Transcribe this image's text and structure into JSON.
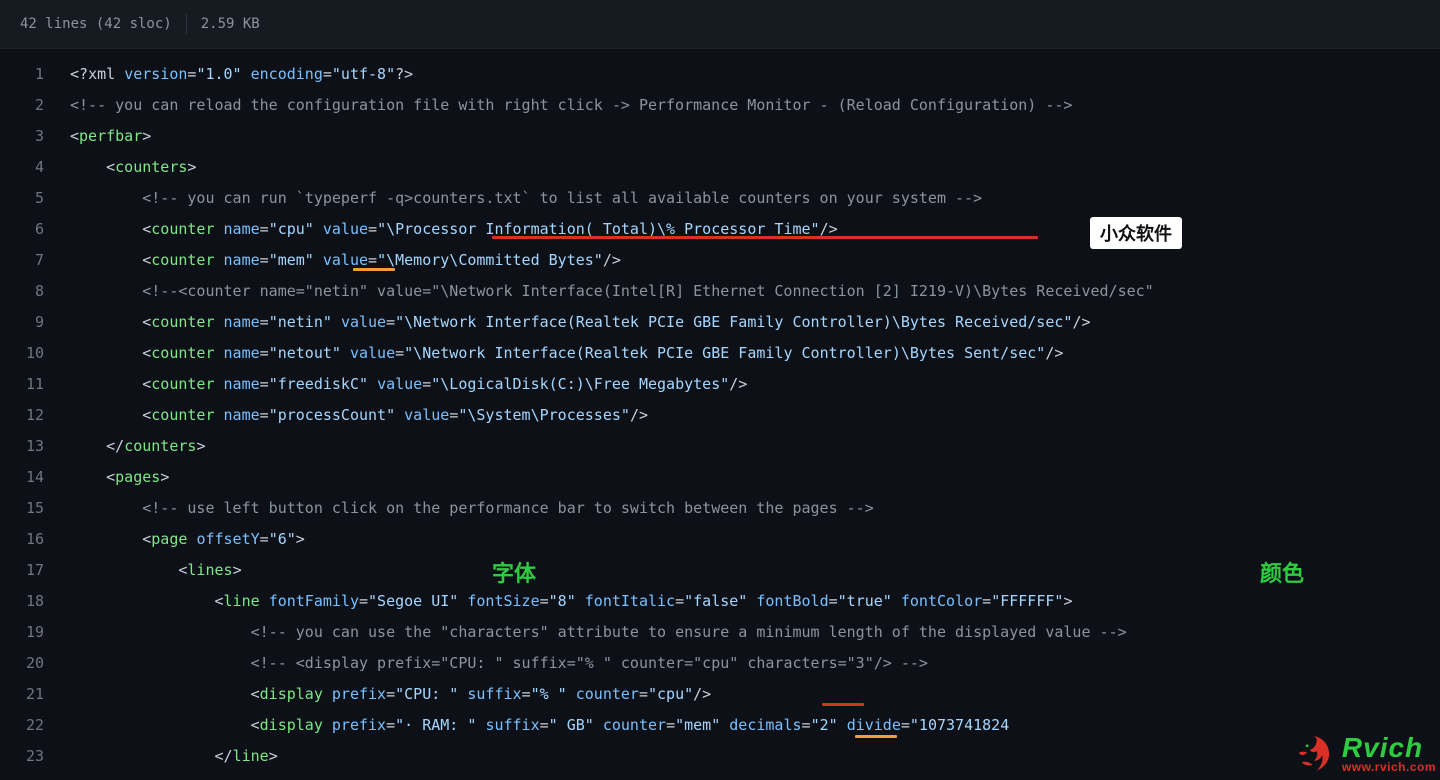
{
  "header": {
    "lines_label": "42 lines (42 sloc)",
    "size_label": "2.59 KB"
  },
  "annotations": {
    "badge_appinn": "小众软件",
    "label_font": "字体",
    "label_color": "颜色"
  },
  "watermark": {
    "brand": "Rvich",
    "url": "www.rvich.com"
  },
  "code_lines": [
    {
      "n": 1,
      "tokens": [
        {
          "t": "ang",
          "v": "<?"
        },
        {
          "t": "pi",
          "v": "xml "
        },
        {
          "t": "attr",
          "v": "version"
        },
        {
          "t": "ang",
          "v": "="
        },
        {
          "t": "str",
          "v": "\"1.0\""
        },
        {
          "t": "pi",
          "v": " "
        },
        {
          "t": "attr",
          "v": "encoding"
        },
        {
          "t": "ang",
          "v": "="
        },
        {
          "t": "str",
          "v": "\"utf-8\""
        },
        {
          "t": "ang",
          "v": "?>"
        }
      ]
    },
    {
      "n": 2,
      "tokens": [
        {
          "t": "cmt",
          "v": "<!-- you can reload the configuration file with right click -> Performance Monitor - (Reload Configuration) -->"
        }
      ]
    },
    {
      "n": 3,
      "tokens": [
        {
          "t": "ang",
          "v": "<"
        },
        {
          "t": "tag",
          "v": "perfbar"
        },
        {
          "t": "ang",
          "v": ">"
        }
      ]
    },
    {
      "n": 4,
      "indent": 1,
      "tokens": [
        {
          "t": "ang",
          "v": "<"
        },
        {
          "t": "tag",
          "v": "counters"
        },
        {
          "t": "ang",
          "v": ">"
        }
      ]
    },
    {
      "n": 5,
      "indent": 2,
      "tokens": [
        {
          "t": "cmt",
          "v": "<!-- you can run `typeperf -q>counters.txt` to list all available counters on your system -->"
        }
      ]
    },
    {
      "n": 6,
      "indent": 2,
      "tokens": [
        {
          "t": "ang",
          "v": "<"
        },
        {
          "t": "tag",
          "v": "counter "
        },
        {
          "t": "attr",
          "v": "name"
        },
        {
          "t": "ang",
          "v": "="
        },
        {
          "t": "str",
          "v": "\"cpu\""
        },
        {
          "t": "pi",
          "v": " "
        },
        {
          "t": "attr",
          "v": "value"
        },
        {
          "t": "ang",
          "v": "="
        },
        {
          "t": "str",
          "v": "\"\\Processor Information(_Total)\\% Processor Time\""
        },
        {
          "t": "ang",
          "v": "/>"
        }
      ]
    },
    {
      "n": 7,
      "indent": 2,
      "tokens": [
        {
          "t": "ang",
          "v": "<"
        },
        {
          "t": "tag",
          "v": "counter "
        },
        {
          "t": "attr",
          "v": "name"
        },
        {
          "t": "ang",
          "v": "="
        },
        {
          "t": "str",
          "v": "\"mem\""
        },
        {
          "t": "pi",
          "v": " "
        },
        {
          "t": "attr",
          "v": "value"
        },
        {
          "t": "ang",
          "v": "="
        },
        {
          "t": "str",
          "v": "\"\\Memory\\Committed Bytes\""
        },
        {
          "t": "ang",
          "v": "/>"
        }
      ]
    },
    {
      "n": 8,
      "indent": 2,
      "tokens": [
        {
          "t": "cmt",
          "v": "<!--<counter name=\"netin\" value=\"\\Network Interface(Intel[R] Ethernet Connection [2] I219-V)\\Bytes Received/sec\""
        }
      ]
    },
    {
      "n": 9,
      "indent": 2,
      "tokens": [
        {
          "t": "ang",
          "v": "<"
        },
        {
          "t": "tag",
          "v": "counter "
        },
        {
          "t": "attr",
          "v": "name"
        },
        {
          "t": "ang",
          "v": "="
        },
        {
          "t": "str",
          "v": "\"netin\""
        },
        {
          "t": "pi",
          "v": " "
        },
        {
          "t": "attr",
          "v": "value"
        },
        {
          "t": "ang",
          "v": "="
        },
        {
          "t": "str",
          "v": "\"\\Network Interface(Realtek PCIe GBE Family Controller)\\Bytes Received/sec\""
        },
        {
          "t": "ang",
          "v": "/>"
        }
      ]
    },
    {
      "n": 10,
      "indent": 2,
      "tokens": [
        {
          "t": "ang",
          "v": "<"
        },
        {
          "t": "tag",
          "v": "counter "
        },
        {
          "t": "attr",
          "v": "name"
        },
        {
          "t": "ang",
          "v": "="
        },
        {
          "t": "str",
          "v": "\"netout\""
        },
        {
          "t": "pi",
          "v": " "
        },
        {
          "t": "attr",
          "v": "value"
        },
        {
          "t": "ang",
          "v": "="
        },
        {
          "t": "str",
          "v": "\"\\Network Interface(Realtek PCIe GBE Family Controller)\\Bytes Sent/sec\""
        },
        {
          "t": "ang",
          "v": "/>"
        }
      ]
    },
    {
      "n": 11,
      "indent": 2,
      "tokens": [
        {
          "t": "ang",
          "v": "<"
        },
        {
          "t": "tag",
          "v": "counter "
        },
        {
          "t": "attr",
          "v": "name"
        },
        {
          "t": "ang",
          "v": "="
        },
        {
          "t": "str",
          "v": "\"freediskC\""
        },
        {
          "t": "pi",
          "v": " "
        },
        {
          "t": "attr",
          "v": "value"
        },
        {
          "t": "ang",
          "v": "="
        },
        {
          "t": "str",
          "v": "\"\\LogicalDisk(C:)\\Free Megabytes\""
        },
        {
          "t": "ang",
          "v": "/>"
        }
      ]
    },
    {
      "n": 12,
      "indent": 2,
      "tokens": [
        {
          "t": "ang",
          "v": "<"
        },
        {
          "t": "tag",
          "v": "counter "
        },
        {
          "t": "attr",
          "v": "name"
        },
        {
          "t": "ang",
          "v": "="
        },
        {
          "t": "str",
          "v": "\"processCount\""
        },
        {
          "t": "pi",
          "v": " "
        },
        {
          "t": "attr",
          "v": "value"
        },
        {
          "t": "ang",
          "v": "="
        },
        {
          "t": "str",
          "v": "\"\\System\\Processes\""
        },
        {
          "t": "ang",
          "v": "/>"
        }
      ]
    },
    {
      "n": 13,
      "indent": 1,
      "tokens": [
        {
          "t": "ang",
          "v": "</"
        },
        {
          "t": "tag",
          "v": "counters"
        },
        {
          "t": "ang",
          "v": ">"
        }
      ]
    },
    {
      "n": 14,
      "indent": 1,
      "tokens": [
        {
          "t": "ang",
          "v": "<"
        },
        {
          "t": "tag",
          "v": "pages"
        },
        {
          "t": "ang",
          "v": ">"
        }
      ]
    },
    {
      "n": 15,
      "indent": 2,
      "tokens": [
        {
          "t": "cmt",
          "v": "<!-- use left button click on the performance bar to switch between the pages -->"
        }
      ]
    },
    {
      "n": 16,
      "indent": 2,
      "tokens": [
        {
          "t": "ang",
          "v": "<"
        },
        {
          "t": "tag",
          "v": "page "
        },
        {
          "t": "attr",
          "v": "offsetY"
        },
        {
          "t": "ang",
          "v": "="
        },
        {
          "t": "str",
          "v": "\"6\""
        },
        {
          "t": "ang",
          "v": ">"
        }
      ]
    },
    {
      "n": 17,
      "indent": 3,
      "tokens": [
        {
          "t": "ang",
          "v": "<"
        },
        {
          "t": "tag",
          "v": "lines"
        },
        {
          "t": "ang",
          "v": ">"
        }
      ]
    },
    {
      "n": 18,
      "indent": 4,
      "tokens": [
        {
          "t": "ang",
          "v": "<"
        },
        {
          "t": "tag",
          "v": "line "
        },
        {
          "t": "attr",
          "v": "fontFamily"
        },
        {
          "t": "ang",
          "v": "="
        },
        {
          "t": "str",
          "v": "\"Segoe UI\""
        },
        {
          "t": "pi",
          "v": " "
        },
        {
          "t": "attr",
          "v": "fontSize"
        },
        {
          "t": "ang",
          "v": "="
        },
        {
          "t": "str",
          "v": "\"8\""
        },
        {
          "t": "pi",
          "v": " "
        },
        {
          "t": "attr",
          "v": "fontItalic"
        },
        {
          "t": "ang",
          "v": "="
        },
        {
          "t": "str",
          "v": "\"false\""
        },
        {
          "t": "pi",
          "v": " "
        },
        {
          "t": "attr",
          "v": "fontBold"
        },
        {
          "t": "ang",
          "v": "="
        },
        {
          "t": "str",
          "v": "\"true\""
        },
        {
          "t": "pi",
          "v": " "
        },
        {
          "t": "attr",
          "v": "fontColor"
        },
        {
          "t": "ang",
          "v": "="
        },
        {
          "t": "str",
          "v": "\"FFFFFF\""
        },
        {
          "t": "ang",
          "v": ">"
        }
      ]
    },
    {
      "n": 19,
      "indent": 5,
      "tokens": [
        {
          "t": "cmt",
          "v": "<!-- you can use the \"characters\" attribute to ensure a minimum length of the displayed value -->"
        }
      ]
    },
    {
      "n": 20,
      "indent": 5,
      "tokens": [
        {
          "t": "cmt",
          "v": "<!-- <display prefix=\"CPU: \" suffix=\"% \" counter=\"cpu\" characters=\"3\"/> -->"
        }
      ]
    },
    {
      "n": 21,
      "indent": 5,
      "tokens": [
        {
          "t": "ang",
          "v": "<"
        },
        {
          "t": "tag",
          "v": "display "
        },
        {
          "t": "attr",
          "v": "prefix"
        },
        {
          "t": "ang",
          "v": "="
        },
        {
          "t": "str",
          "v": "\"CPU: \""
        },
        {
          "t": "pi",
          "v": " "
        },
        {
          "t": "attr",
          "v": "suffix"
        },
        {
          "t": "ang",
          "v": "="
        },
        {
          "t": "str",
          "v": "\"% \""
        },
        {
          "t": "pi",
          "v": " "
        },
        {
          "t": "attr",
          "v": "counter"
        },
        {
          "t": "ang",
          "v": "="
        },
        {
          "t": "str",
          "v": "\"cpu\""
        },
        {
          "t": "ang",
          "v": "/>"
        }
      ]
    },
    {
      "n": 22,
      "indent": 5,
      "tokens": [
        {
          "t": "ang",
          "v": "<"
        },
        {
          "t": "tag",
          "v": "display "
        },
        {
          "t": "attr",
          "v": "prefix"
        },
        {
          "t": "ang",
          "v": "="
        },
        {
          "t": "str",
          "v": "\"· RAM: \""
        },
        {
          "t": "pi",
          "v": " "
        },
        {
          "t": "attr",
          "v": "suffix"
        },
        {
          "t": "ang",
          "v": "="
        },
        {
          "t": "str",
          "v": "\" GB\""
        },
        {
          "t": "pi",
          "v": " "
        },
        {
          "t": "attr",
          "v": "counter"
        },
        {
          "t": "ang",
          "v": "="
        },
        {
          "t": "str",
          "v": "\"mem\""
        },
        {
          "t": "pi",
          "v": " "
        },
        {
          "t": "attr",
          "v": "decimals"
        },
        {
          "t": "ang",
          "v": "="
        },
        {
          "t": "str",
          "v": "\"2\""
        },
        {
          "t": "pi",
          "v": " "
        },
        {
          "t": "attr",
          "v": "divide"
        },
        {
          "t": "ang",
          "v": "="
        },
        {
          "t": "str",
          "v": "\"1073741824"
        }
      ]
    },
    {
      "n": 23,
      "indent": 4,
      "tokens": [
        {
          "t": "ang",
          "v": "</"
        },
        {
          "t": "tag",
          "v": "line"
        },
        {
          "t": "ang",
          "v": ">"
        }
      ]
    }
  ]
}
